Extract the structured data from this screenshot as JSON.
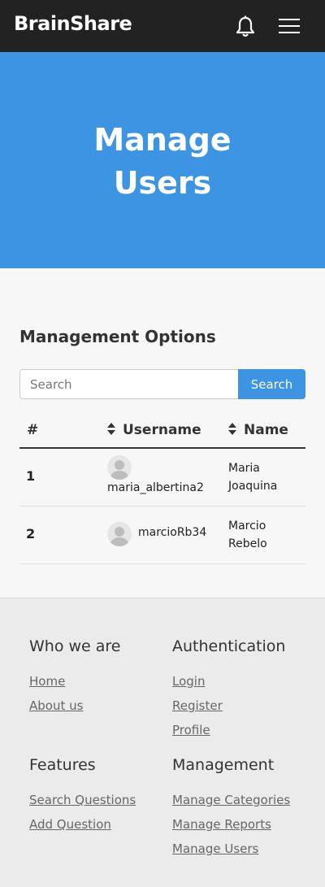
{
  "navbar": {
    "brand": "BrainShare",
    "notification_icon": "bell-icon",
    "menu_icon": "hamburger-icon"
  },
  "hero": {
    "title_line1": "Manage",
    "title_line2": "Users"
  },
  "management": {
    "title": "Management Options",
    "search": {
      "placeholder": "Search",
      "value": ""
    },
    "search_button": "Search",
    "table": {
      "headers": [
        "#",
        "Username",
        "Name"
      ],
      "rows": [
        {
          "id": "1",
          "username": "maria_albertina2",
          "name": "Maria Joaquina"
        },
        {
          "id": "2",
          "username": "marcioRb34",
          "name": "Marcio Rebelo"
        }
      ]
    }
  },
  "footer": {
    "who": {
      "title": "Who we are",
      "links": [
        "Home",
        "About us"
      ]
    },
    "auth": {
      "title": "Authentication",
      "links": [
        "Login",
        "Register",
        "Profile"
      ]
    },
    "features": {
      "title": "Features",
      "links": [
        "Search Questions",
        "Add Question"
      ]
    },
    "management": {
      "title": "Management",
      "links": [
        "Manage Categories",
        "Manage Reports",
        "Manage Users"
      ]
    }
  },
  "colors": {
    "primary": "#3c94e3",
    "navbar": "#222222",
    "footer": "#ebebeb"
  }
}
